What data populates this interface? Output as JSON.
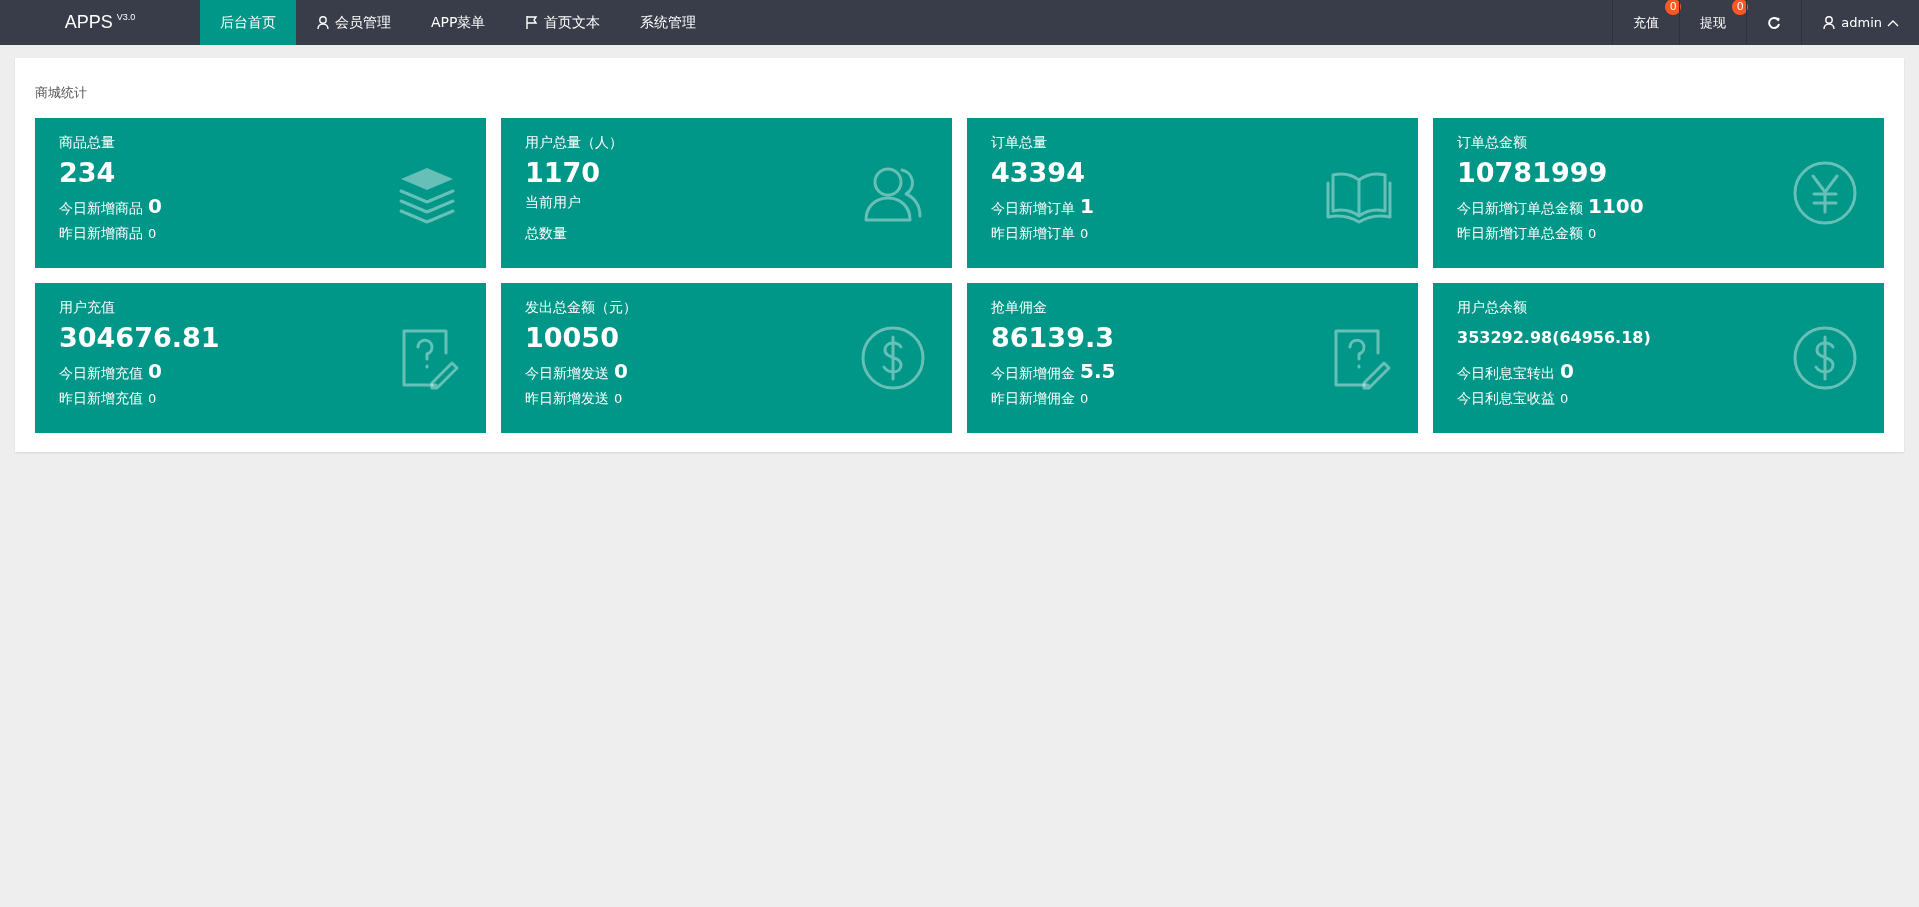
{
  "header": {
    "logo": "APPS",
    "version": "V3.0",
    "nav": [
      {
        "label": "后台首页",
        "selected": true
      },
      {
        "label": "会员管理",
        "selected": false
      },
      {
        "label": "APP菜单",
        "selected": false
      },
      {
        "label": "首页文本",
        "selected": false
      },
      {
        "label": "系统管理",
        "selected": false
      }
    ],
    "right": [
      {
        "kind": "text",
        "label": "充值",
        "badge": "0"
      },
      {
        "kind": "text",
        "label": "提现",
        "badge": "0"
      },
      {
        "kind": "refresh"
      },
      {
        "kind": "user",
        "label": "admin"
      }
    ]
  },
  "panel": {
    "title": "商城统计",
    "cards": [
      {
        "kind": "large",
        "title": "商品总量",
        "value": "234",
        "lines": [
          {
            "label": "今日新增商品",
            "value": "0"
          },
          {
            "label": "昨日新增商品",
            "value": "0"
          }
        ]
      },
      {
        "kind": "large",
        "title": "用户总量（人）",
        "value": "1170",
        "lines": [
          {
            "label": "当前用户"
          },
          {
            "label": "总数量"
          }
        ]
      },
      {
        "kind": "large",
        "title": "订单总量",
        "value": "43394",
        "lines": [
          {
            "label": "今日新增订单",
            "value": "1"
          },
          {
            "label": "昨日新增订单",
            "value": "0"
          }
        ]
      },
      {
        "kind": "large",
        "title": "订单总金额",
        "value": "10781999",
        "lines": [
          {
            "label": "今日新增订单总金额",
            "value": "1100"
          },
          {
            "label": "昨日新增订单总金额",
            "value": "0"
          }
        ]
      },
      {
        "kind": "large",
        "title": "用户充值",
        "value": "304676.81",
        "lines": [
          {
            "label": "今日新增充值",
            "value": "0"
          },
          {
            "label": "昨日新增充值",
            "value": "0"
          }
        ]
      },
      {
        "kind": "large",
        "title": "发出总金额（元）",
        "value": "10050",
        "lines": [
          {
            "label": "今日新增发送",
            "value": "0"
          },
          {
            "label": "昨日新增发送",
            "value": "0"
          }
        ]
      },
      {
        "kind": "large",
        "title": "抢单佣金",
        "value": "86139.3",
        "lines": [
          {
            "label": "今日新增佣金",
            "value": "5.5"
          },
          {
            "label": "昨日新增佣金",
            "value": "0"
          }
        ]
      },
      {
        "kind": "small",
        "title": "用户总余额",
        "value": "353292.98(64956.18)",
        "lines": [
          {
            "label": "今日利息宝转出",
            "value": "0"
          },
          {
            "label": "今日利息宝收益",
            "value": "0"
          }
        ]
      }
    ]
  }
}
